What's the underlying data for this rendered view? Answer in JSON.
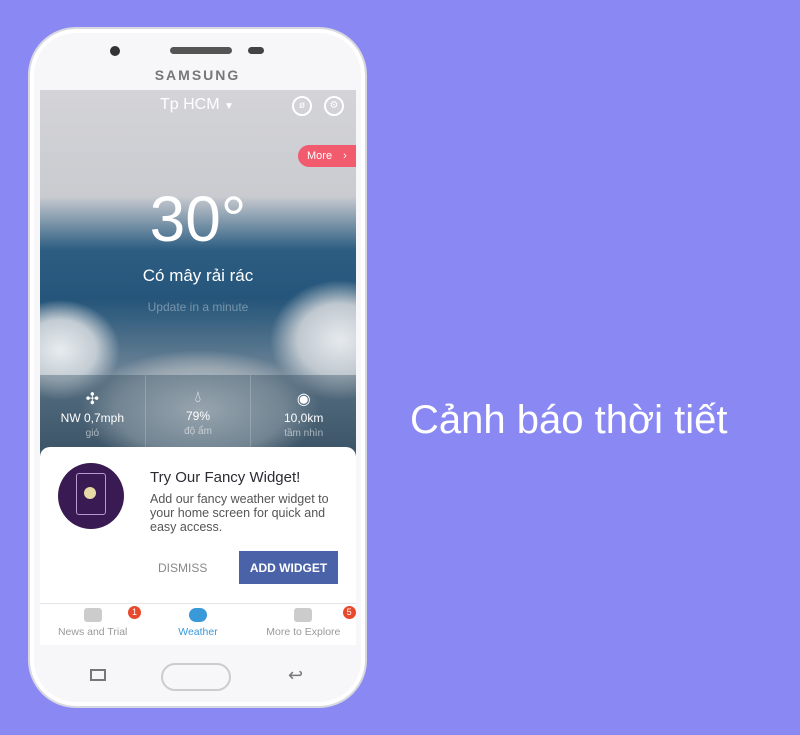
{
  "device": {
    "brand": "SAMSUNG"
  },
  "header": {
    "city": "Tp HCM",
    "dropdown_icon": "caret-down",
    "icons": [
      "no-ads-icon",
      "gear-icon"
    ]
  },
  "more_button": "More",
  "weather": {
    "temperature": "30°",
    "condition": "Có mây rải rác",
    "update_text": "Update in a minute"
  },
  "stats": [
    {
      "icon": "wind-fan",
      "value": "NW 0,7mph",
      "label": "gió"
    },
    {
      "icon": "droplet",
      "value": "79%",
      "label": "độ ẩm"
    },
    {
      "icon": "eye",
      "value": "10,0km",
      "label": "tầm nhìn"
    }
  ],
  "card": {
    "title": "Try Our Fancy Widget!",
    "description": "Add our fancy weather widget to your home screen for quick and easy access.",
    "dismiss": "DISMISS",
    "add": "ADD WIDGET"
  },
  "nav": [
    {
      "label": "News and Trial",
      "badge": "1",
      "active": false
    },
    {
      "label": "Weather",
      "active": true
    },
    {
      "label": "More to Explore",
      "badge": "5",
      "active": false
    }
  ],
  "colors": {
    "background": "#8a89f3",
    "more": "#f25b6e",
    "button": "#4a63a8",
    "active": "#3a9ad9",
    "badge": "#e8492c"
  },
  "caption": "Cảnh báo thời tiết"
}
